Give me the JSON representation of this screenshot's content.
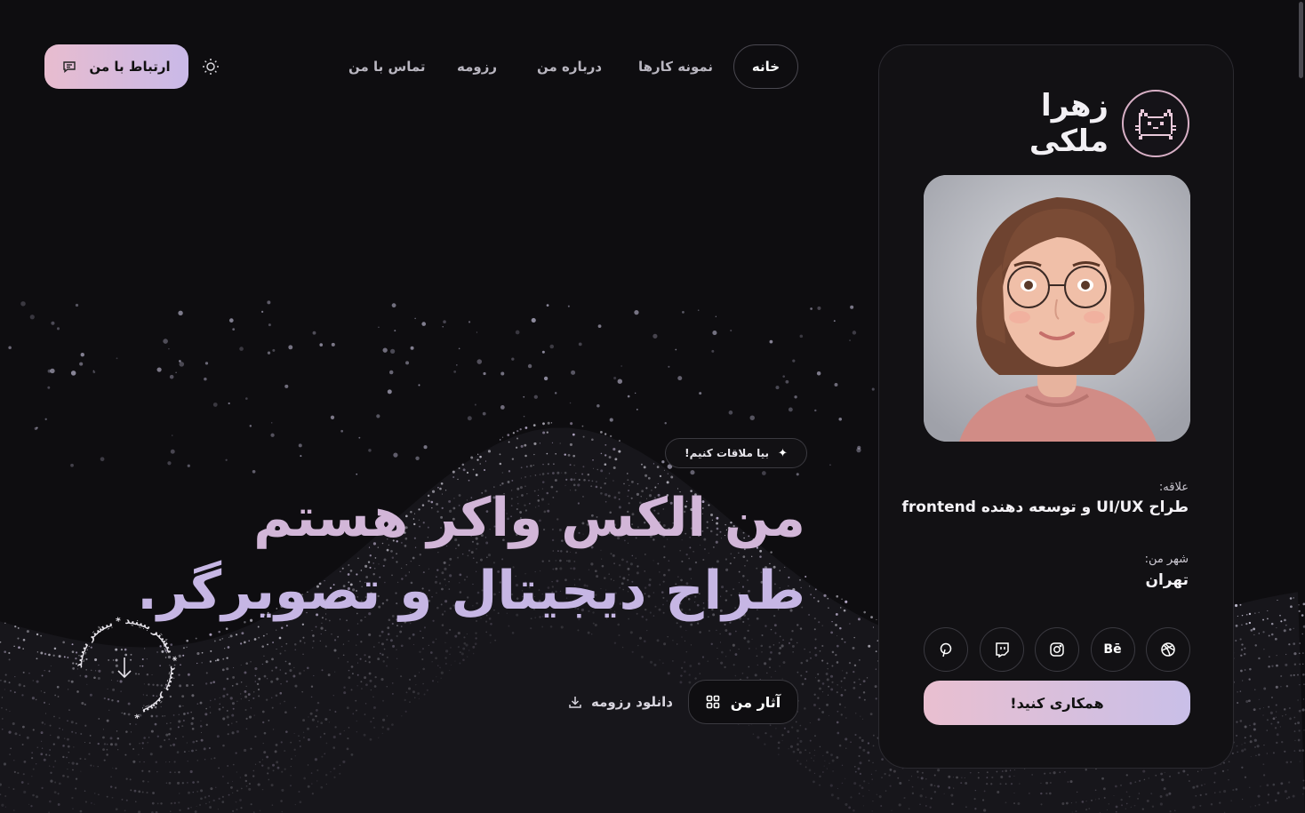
{
  "nav": {
    "items": [
      {
        "label": "خانه",
        "active": true
      },
      {
        "label": "نمونه کارها",
        "active": false
      },
      {
        "label": "درباره من",
        "active": false
      },
      {
        "label": "رزومه",
        "active": false
      },
      {
        "label": "تماس با من",
        "active": false
      }
    ],
    "contact_label": "ارتباط با من",
    "contact_icon": "chat-icon",
    "theme_icon": "sun-icon"
  },
  "card": {
    "name_line1": "زهرا",
    "name_line2": "ملکی",
    "logo_icon": "pixel-cat-icon",
    "interest_label": "علاقه:",
    "interest_value": "طراح UI/UX و توسعه دهنده frontend",
    "city_label": "شهر من:",
    "city_value": "تهران",
    "socials": [
      {
        "icon": "dribbble-icon",
        "text": ""
      },
      {
        "icon": "behance-icon",
        "text": "Bē"
      },
      {
        "icon": "instagram-icon",
        "text": ""
      },
      {
        "icon": "twitch-icon",
        "text": ""
      },
      {
        "icon": "pinterest-icon",
        "text": ""
      }
    ],
    "collab_label": "همکاری کنید!"
  },
  "hero": {
    "badge": "بیا ملاقات کنیم!",
    "line1": "من الکس واکر هستم",
    "line2": "طراح دیجیتال و تصویرگر.",
    "works_label": "آثار من",
    "resume_label": "دانلود رزومه",
    "scroll_text": "بیشتر ببینید * بیشتر ببینید * بیشتر ببینید * "
  },
  "colors": {
    "accent_pink": "#e8bccf",
    "accent_lavender": "#c9b9e8",
    "background": "#0e0d10"
  }
}
